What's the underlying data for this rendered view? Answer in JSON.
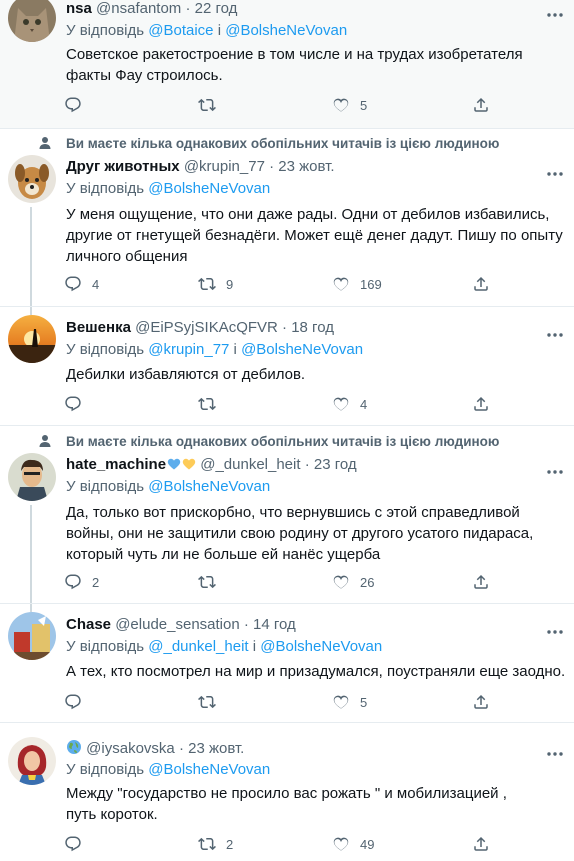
{
  "tweets": [
    {
      "name": "nsa",
      "handle": "@nsafantom",
      "time": "· 22 год",
      "reply_prefix": "У відповідь",
      "reply_to": [
        "@Botaice",
        "@BolsheNeVovan"
      ],
      "reply_joiner": "і",
      "text": "Советское ракетостроение в том числе и на трудах изобретателя факты Фау строилось.",
      "replies": "",
      "retweets": "",
      "likes": "5"
    },
    {
      "social": "Ви маєте кілька однакових обопільних читачів із цією людиною",
      "name": "Друг животных",
      "handle": "@krupin_77",
      "time": "· 23 жовт.",
      "reply_prefix": "У відповідь",
      "reply_to": [
        "@BolsheNeVovan"
      ],
      "text": "У меня ощущение, что они даже рады. Одни от дебилов избавились, другие от гнетущей безнадёги. Может ещё денег дадут. Пишу по опыту личного общения",
      "replies": "4",
      "retweets": "9",
      "likes": "169"
    },
    {
      "name": "Вешенка",
      "handle": "@EiPSyjSIKAcQFVR",
      "time": "· 18 год",
      "reply_prefix": "У відповідь",
      "reply_to": [
        "@krupin_77",
        "@BolsheNeVovan"
      ],
      "reply_joiner": "і",
      "text": "Дебилки избавляются от дебилов.",
      "replies": "",
      "retweets": "",
      "likes": "4"
    },
    {
      "social": "Ви маєте кілька однакових обопільних читачів із цією людиною",
      "name": "hate_machine",
      "handle": "@_dunkel_heit",
      "time": "· 23 год",
      "reply_prefix": "У відповідь",
      "reply_to": [
        "@BolsheNeVovan"
      ],
      "text": "Да, только вот прискорбно, что вернувшись с этой справедливой войны, они не защитили свою родину от другого усатого пидараса, который чуть ли не больше ей нанёс ущерба",
      "replies": "2",
      "retweets": "",
      "likes": "26"
    },
    {
      "name": "Chase",
      "handle": "@elude_sensation",
      "time": "· 14 год",
      "reply_prefix": "У відповідь",
      "reply_to": [
        "@_dunkel_heit",
        "@BolsheNeVovan"
      ],
      "reply_joiner": "і",
      "text": "А тех, кто посмотрел на мир и призадумался, поустраняли еще заодно.",
      "replies": "",
      "retweets": "",
      "likes": "5"
    },
    {
      "name": "",
      "handle": "@iysakovska",
      "time": "· 23 жовт.",
      "reply_prefix": "У відповідь",
      "reply_to": [
        "@BolsheNeVovan"
      ],
      "text": "Между \"государство не просило вас рожать \" и мобилизацией , путь короток.",
      "replies": "",
      "retweets": "2",
      "likes": "49"
    }
  ],
  "colors": {
    "accent": "#1d9bf0",
    "muted": "#536471",
    "text": "#0f1419",
    "divider": "#e6ecf0"
  }
}
